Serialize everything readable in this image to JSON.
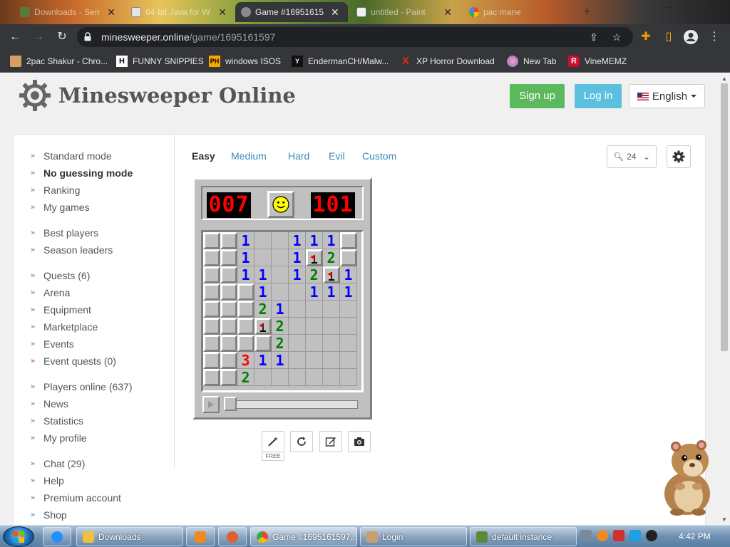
{
  "browser": {
    "tabs": [
      {
        "title": "Downloads - Sen",
        "favicon": "download-icon",
        "active": false
      },
      {
        "title": "64-bit Java for W",
        "favicon": "java-icon",
        "active": false
      },
      {
        "title": "Game #1695161597",
        "favicon": "minesweeper-icon",
        "active": true
      },
      {
        "title": "untitled - Paint",
        "favicon": "paint-icon",
        "active": false
      },
      {
        "title": "pac mane",
        "favicon": "google-icon",
        "active": false
      }
    ],
    "url_domain": "minesweeper.online",
    "url_path": "/game/1695161597",
    "bookmarks": [
      {
        "label": "2pac Shakur - Chro...",
        "icon": "bookmark-icon"
      },
      {
        "label": "FUNNY SNIPPIES",
        "icon": "H"
      },
      {
        "label": "windows ISOS",
        "icon": "PH"
      },
      {
        "label": "EndermanCH/Malw...",
        "icon": "Y"
      },
      {
        "label": "XP Horror Download",
        "icon": "X"
      },
      {
        "label": "New Tab",
        "icon": "globe-icon"
      },
      {
        "label": "VineMEMZ",
        "icon": "R"
      }
    ]
  },
  "site": {
    "title": "Minesweeper Online",
    "signup": "Sign up",
    "login": "Log in",
    "language": "English"
  },
  "sidebar": {
    "items": [
      {
        "label": "Standard mode"
      },
      {
        "label": "No guessing mode",
        "bold": true
      },
      {
        "label": "Ranking"
      },
      {
        "label": "My games"
      },
      {
        "label": "Best players"
      },
      {
        "label": "Season leaders"
      },
      {
        "label": "Quests (6)"
      },
      {
        "label": "Arena"
      },
      {
        "label": "Equipment"
      },
      {
        "label": "Marketplace"
      },
      {
        "label": "Events"
      },
      {
        "label": "Event quests (0)",
        "red_arrow": true
      },
      {
        "label": "Players online (637)"
      },
      {
        "label": "News"
      },
      {
        "label": "Statistics"
      },
      {
        "label": "My profile"
      },
      {
        "label": "Chat (29)"
      },
      {
        "label": "Help"
      },
      {
        "label": "Premium account"
      },
      {
        "label": "Shop"
      }
    ]
  },
  "difficulty": {
    "tabs": [
      "Easy",
      "Medium",
      "Hard",
      "Evil",
      "Custom"
    ],
    "selected": "Easy"
  },
  "zoom": "24",
  "game": {
    "mines_left": "007",
    "timer": "101",
    "face": "smiley-face-icon",
    "board": [
      [
        "c",
        "c",
        "1",
        "o",
        "o",
        "1",
        "1",
        "1",
        "c"
      ],
      [
        "c",
        "c",
        "1",
        "o",
        "o",
        "1",
        "F",
        "2",
        "c"
      ],
      [
        "c",
        "c",
        "1",
        "1",
        "o",
        "1",
        "2",
        "F",
        "1"
      ],
      [
        "c",
        "c",
        "c",
        "1",
        "o",
        "o",
        "1",
        "1",
        "1"
      ],
      [
        "c",
        "c",
        "c",
        "2",
        "1",
        "o",
        "o",
        "o",
        "o"
      ],
      [
        "c",
        "c",
        "c",
        "F",
        "2",
        "o",
        "o",
        "o",
        "o"
      ],
      [
        "c",
        "c",
        "c",
        "c",
        "2",
        "o",
        "o",
        "o",
        "o"
      ],
      [
        "c",
        "c",
        "3",
        "1",
        "1",
        "o",
        "o",
        "o",
        "o"
      ],
      [
        "c",
        "c",
        "2",
        "o",
        "o",
        "o",
        "o",
        "o",
        "o"
      ]
    ],
    "legend": {
      "c": "closed",
      "o": "empty",
      "F": "flag"
    }
  },
  "tools": {
    "hint_badge": "FREE",
    "icons": [
      "magic-wand-icon",
      "restart-icon",
      "edit-icon",
      "screenshot-icon"
    ]
  },
  "taskbar": {
    "items": [
      {
        "label": "Downloads",
        "icon": "folder-icon"
      },
      {
        "label": "Game #1695161597...",
        "icon": "chrome-icon"
      },
      {
        "label": "Login",
        "icon": "login-app-icon"
      },
      {
        "label": "default instance",
        "icon": "minecraft-icon"
      }
    ],
    "clock": "4:42 PM"
  }
}
